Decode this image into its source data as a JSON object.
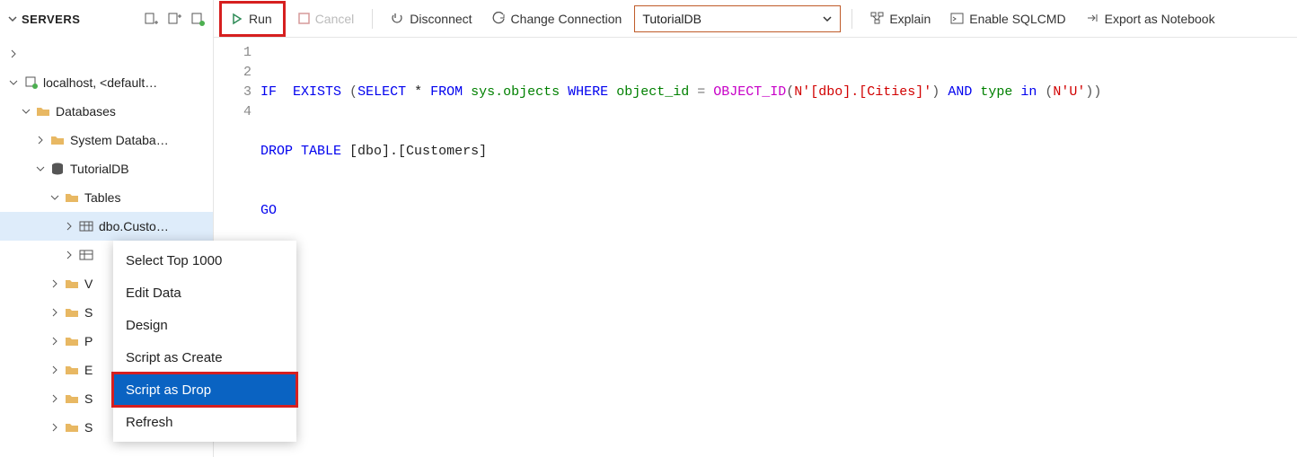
{
  "sidebar": {
    "title": "SERVERS",
    "nodes": {
      "localhost": "localhost, <default…",
      "databases": "Databases",
      "system_db": "System Databa…",
      "tutorialdb": "TutorialDB",
      "tables": "Tables",
      "dbo_custo": "dbo.Custo…",
      "folder_v": "V",
      "folder_s1": "S",
      "folder_p": "P",
      "folder_e": "E",
      "folder_s2": "S",
      "folder_s3": "S"
    }
  },
  "toolbar": {
    "run": "Run",
    "cancel": "Cancel",
    "disconnect": "Disconnect",
    "change_conn": "Change Connection",
    "db_selected": "TutorialDB",
    "explain": "Explain",
    "enable_sqlcmd": "Enable SQLCMD",
    "export_nb": "Export as Notebook"
  },
  "editor": {
    "lines": [
      "1",
      "2",
      "3",
      "4"
    ],
    "l1": {
      "if": "IF",
      "exists": "EXISTS",
      "op1": " (",
      "select": "SELECT",
      "star": " * ",
      "from": "FROM",
      "sp1": " ",
      "sysobj": "sys.objects",
      "sp2": " ",
      "where": "WHERE",
      "sp3": " ",
      "oid": "object_id",
      "eq": " = ",
      "fn": "OBJECT_ID",
      "op2": "(",
      "n1": "N'[dbo].[Cities]'",
      "op3": ") ",
      "and": "AND",
      "sp4": " ",
      "type": "type",
      "sp5": " ",
      "in": "in",
      "op4": " (",
      "n2": "N'U'",
      "op5": "))"
    },
    "l2": {
      "drop": "DROP",
      "sp1": " ",
      "table": "TABLE",
      "rest": " [dbo].[Customers]"
    },
    "l3": {
      "go": "GO"
    }
  },
  "context_menu": {
    "select_top": "Select Top 1000",
    "edit_data": "Edit Data",
    "design": "Design",
    "script_create": "Script as Create",
    "script_drop": "Script as Drop",
    "refresh": "Refresh"
  }
}
